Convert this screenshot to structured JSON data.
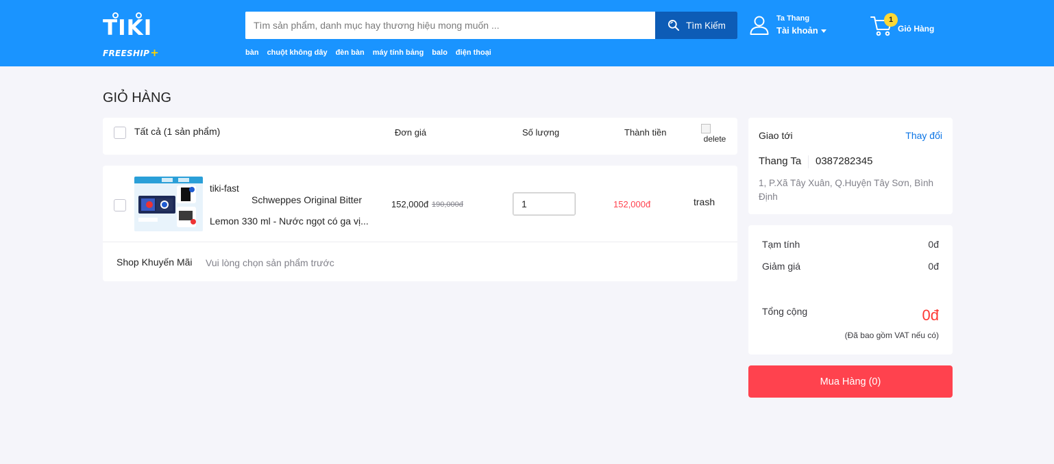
{
  "header": {
    "logo_text": "TIKI",
    "logo_tagline": "FREESHIP",
    "logo_plus": "+",
    "search": {
      "placeholder": "Tìm sản phẩm, danh mục hay thương hiệu mong muốn ...",
      "value": "",
      "button_label": "Tìm Kiếm",
      "icon": "search-icon"
    },
    "quick_links": [
      "bàn",
      "chuột không dây",
      "đèn bàn",
      "máy tính bảng",
      "balo",
      "điện thoại"
    ],
    "account": {
      "user_name": "Ta Thang",
      "label": "Tài khoản",
      "icon": "user-icon"
    },
    "cart": {
      "badge_count": "1",
      "label": "Giỏ Hàng",
      "icon": "cart-icon"
    },
    "colors": {
      "header_bg": "#1a94ff",
      "search_button_bg": "#0d5cb6",
      "badge_bg": "#fdd835"
    }
  },
  "page": {
    "title": "GIỎ HÀNG"
  },
  "cart_table": {
    "select_all_label": "Tất cả (1 sản phẩm)",
    "columns": {
      "unit_price": "Đơn giá",
      "quantity": "Số lượng",
      "line_total": "Thành tiền"
    },
    "delete_alt": "delete",
    "items": [
      {
        "badge_alt": "tiki-fast",
        "name_line1": "Schweppes Original Bitter",
        "name_line2": "Lemon 330 ml - Nước ngọt có ga vị...",
        "price": "152,000đ",
        "original_price": "190,000đ",
        "quantity": "1",
        "total": "152,000đ",
        "trash_alt": "trash"
      }
    ],
    "promo": {
      "label": "Shop Khuyến Mãi",
      "hint": "Vui lòng chọn sản phẩm trước"
    }
  },
  "shipping": {
    "title": "Giao tới",
    "change_label": "Thay đổi",
    "name": "Thang Ta",
    "phone": "0387282345",
    "address": "1, P.Xã Tây Xuân, Q.Huyện Tây Sơn, Bình Định"
  },
  "summary": {
    "subtotal_label": "Tạm tính",
    "subtotal_value": "0đ",
    "discount_label": "Giảm giá",
    "discount_value": "0đ",
    "total_label": "Tổng cộng",
    "total_value": "0đ",
    "vat_note": "(Đã bao gồm VAT nếu có)"
  },
  "checkout": {
    "button_label": "Mua Hàng (0)",
    "button_color": "#ff424e"
  }
}
